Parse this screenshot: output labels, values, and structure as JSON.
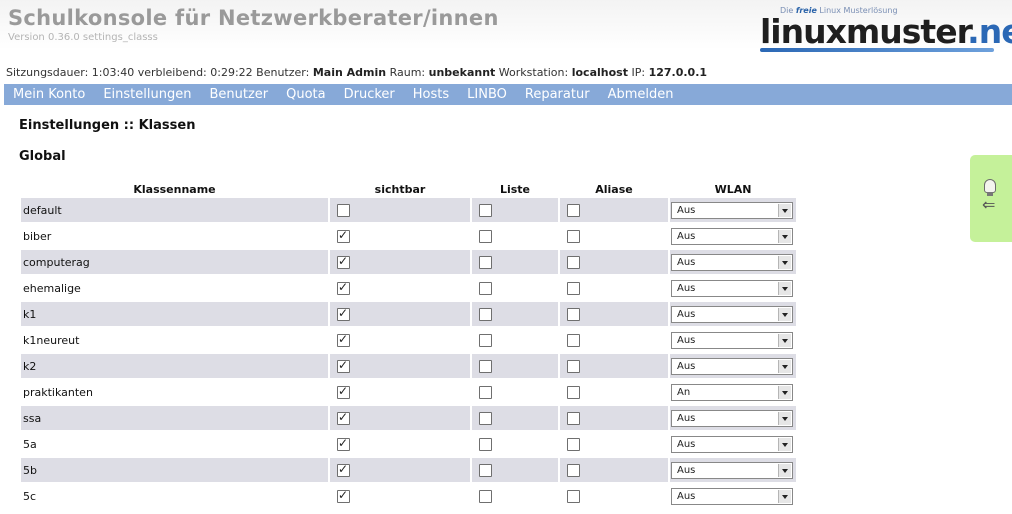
{
  "app": {
    "title": "Schulkonsole für Netzwerkberater/innen",
    "version": "Version 0.36.0 settings_classs"
  },
  "logo": {
    "tagline_pre": "Die ",
    "tagline_strong": "freie",
    "tagline_post": " Linux Musterlösung",
    "main": "linuxmuster",
    "dot": ".",
    "net": "net"
  },
  "session": {
    "duration_label": "Sitzungsdauer:",
    "duration": "1:03:40",
    "remaining_label": "verbleibend:",
    "remaining": "0:29:22",
    "user_label": "Benutzer:",
    "user": "Main Admin",
    "room_label": "Raum:",
    "room": "unbekannt",
    "workstation_label": "Workstation:",
    "workstation": "localhost",
    "ip_label": "IP:",
    "ip": "127.0.0.1"
  },
  "nav": [
    "Mein Konto",
    "Einstellungen",
    "Benutzer",
    "Quota",
    "Drucker",
    "Hosts",
    "LINBO",
    "Reparatur",
    "Abmelden"
  ],
  "page": {
    "title": "Einstellungen :: Klassen",
    "section": "Global"
  },
  "table": {
    "headers": [
      "Klassenname",
      "sichtbar",
      "Liste",
      "Aliase",
      "WLAN"
    ],
    "rows": [
      {
        "name": "default",
        "sichtbar": false,
        "liste": false,
        "aliase": false,
        "wlan": "Aus"
      },
      {
        "name": "biber",
        "sichtbar": true,
        "liste": false,
        "aliase": false,
        "wlan": "Aus"
      },
      {
        "name": "computerag",
        "sichtbar": true,
        "liste": false,
        "aliase": false,
        "wlan": "Aus"
      },
      {
        "name": "ehemalige",
        "sichtbar": true,
        "liste": false,
        "aliase": false,
        "wlan": "Aus"
      },
      {
        "name": "k1",
        "sichtbar": true,
        "liste": false,
        "aliase": false,
        "wlan": "Aus"
      },
      {
        "name": "k1neureut",
        "sichtbar": true,
        "liste": false,
        "aliase": false,
        "wlan": "Aus"
      },
      {
        "name": "k2",
        "sichtbar": true,
        "liste": false,
        "aliase": false,
        "wlan": "Aus"
      },
      {
        "name": "praktikanten",
        "sichtbar": true,
        "liste": false,
        "aliase": false,
        "wlan": "An"
      },
      {
        "name": "ssa",
        "sichtbar": true,
        "liste": false,
        "aliase": false,
        "wlan": "Aus"
      },
      {
        "name": "5a",
        "sichtbar": true,
        "liste": false,
        "aliase": false,
        "wlan": "Aus"
      },
      {
        "name": "5b",
        "sichtbar": true,
        "liste": false,
        "aliase": false,
        "wlan": "Aus"
      },
      {
        "name": "5c",
        "sichtbar": true,
        "liste": false,
        "aliase": false,
        "wlan": "Aus"
      }
    ]
  }
}
